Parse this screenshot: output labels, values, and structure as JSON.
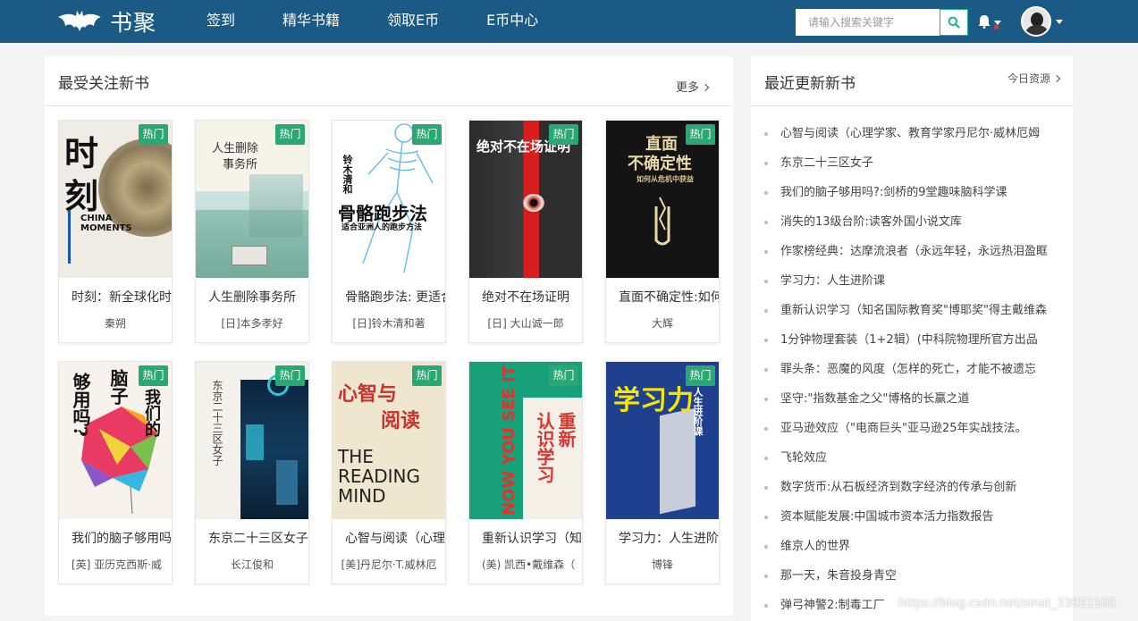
{
  "header": {
    "logo_text": "书聚",
    "nav": [
      "签到",
      "精华书籍",
      "领取E币",
      "E币中心"
    ],
    "search_placeholder": "请输入搜索关键字"
  },
  "left_panel": {
    "title": "最受关注新书",
    "more": "更多",
    "badge": "热门",
    "books": [
      {
        "title": "时刻：新全球化时代",
        "author": "秦朔",
        "cover_lines": [
          "时",
          "刻",
          "CHINA",
          "MOMENTS"
        ]
      },
      {
        "title": "人生删除事务所",
        "author": "[日]本多孝好",
        "cover_lines": [
          "人生删除",
          "事务所"
        ]
      },
      {
        "title": "骨骼跑步法: 更适合亚洲人的跑步方法",
        "author": "[日]铃木清和著",
        "cover_lines": [
          "骨骼跑步法",
          "适合亚洲人的跑步方法",
          "铃木清和"
        ]
      },
      {
        "title": "绝对不在场证明",
        "author": "[日] 大山诚一郎",
        "cover_lines": [
          "绝对不在场证明"
        ]
      },
      {
        "title": "直面不确定性:如何",
        "author": "大辉",
        "cover_lines": [
          "直面",
          "不确定性",
          "如何从危机中获益"
        ]
      },
      {
        "title": "我们的脑子够用吗?",
        "author": "[英] 亚历克西斯·威",
        "cover_lines": [
          "我们的",
          "脑子",
          "够用吗?"
        ]
      },
      {
        "title": "东京二十三区女子",
        "author": "长江俊和",
        "cover_lines": [
          "东京二十三区女子"
        ]
      },
      {
        "title": "心智与阅读（心理学家",
        "author": "[美]丹尼尔·T.威林厄",
        "cover_lines": [
          "心智与",
          "阅读",
          "THE",
          "READING",
          "MIND"
        ]
      },
      {
        "title": "重新认识学习（知名",
        "author": "(美) 凯西•戴维森（",
        "cover_lines": [
          "重新",
          "认识学习",
          "NOW YOU SEE IT"
        ]
      },
      {
        "title": "学习力：人生进阶课",
        "author": "博锋",
        "cover_lines": [
          "学习力",
          "人生进阶课"
        ]
      }
    ]
  },
  "right_panel": {
    "title": "最近更新新书",
    "more": "今日资源",
    "items": [
      "心智与阅读（心理学家、教育学家丹尼尔·威林厄姆",
      "东京二十三区女子",
      "我们的脑子够用吗?:剑桥的9堂趣味脑科学课",
      "消失的13级台阶:读客外国小说文库",
      "作家榜经典：达摩流浪者（永远年轻，永远热泪盈眶",
      "学习力：人生进阶课",
      "重新认识学习（知名国际教育奖\"博耶奖\"得主戴维森",
      "1分钟物理套装（1+2辑）(中科院物理所官方出品",
      "罪头条：恶魔的风度（怎样的死亡，才能不被遗忘",
      "坚守:\"指数基金之父\"博格的长赢之道",
      "亚马逊效应（\"电商巨头\"亚马逊25年实战技法。",
      "飞轮效应",
      "数字货币:从石板经济到数字经济的传承与创新",
      "资本赋能发展:中国城市资本活力指数报告",
      "维京人的世界",
      "那一天，朱音投身青空",
      "弹弓神警2:制毒工厂"
    ]
  },
  "watermark": "https://blog.csdn.net/sinat_33921105",
  "colors": {
    "header": "#1a5a85",
    "badge": "#2aa873",
    "search_border": "#1ab394"
  }
}
